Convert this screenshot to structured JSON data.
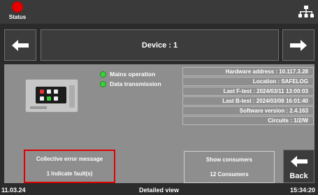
{
  "topbar": {
    "status_label": "Status"
  },
  "header": {
    "title": "Device : 1"
  },
  "indicators": [
    {
      "label": "Mains operation",
      "color": "#3ad13a"
    },
    {
      "label": "Data transmission",
      "color": "#3ad13a"
    }
  ],
  "info": [
    "Hardware address : 10.117.3.28",
    "Location : SAFELOG",
    "Last F-test : 2024/03/11 13:00:03",
    "Last B-test : 2024/03/08 16:01:40",
    "Software version : 2.4.163",
    "Circuits : 1/2/W"
  ],
  "error_box": {
    "title": "Collective error message",
    "detail": "1 Indicate fault(s)",
    "border_color": "#e00000"
  },
  "consumers_box": {
    "title": "Show consumers",
    "detail": "12 Consumers"
  },
  "back_button": {
    "label": "Back"
  },
  "footer": {
    "date": "11.03.24",
    "view": "Detailed view",
    "time": "15:34:20"
  }
}
